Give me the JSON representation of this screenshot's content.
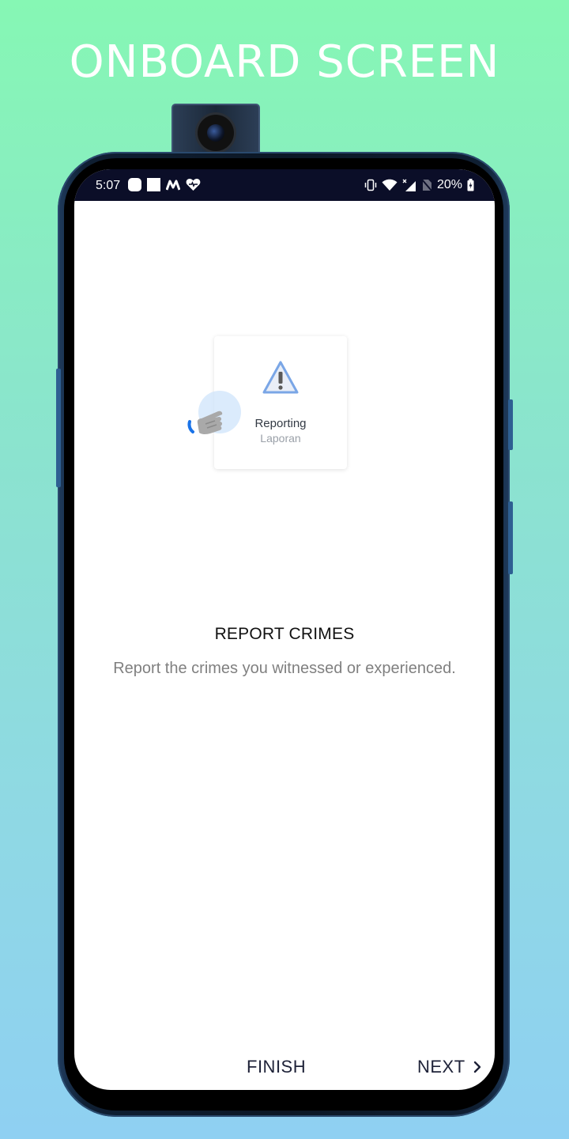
{
  "promo": {
    "title": "ONBOARD SCREEN"
  },
  "status_bar": {
    "time": "5:07",
    "left_icons": [
      "notification-icon",
      "square-icon",
      "m-app-icon",
      "heart-icon"
    ],
    "right_icons": [
      "vibrate-icon",
      "wifi-icon",
      "signal-icon",
      "no-sim-icon"
    ],
    "battery": "20%",
    "background": "#0b0e28"
  },
  "illustration": {
    "card_label": "Reporting",
    "card_sublabel": "Laporan",
    "card_icon": "warning-icon",
    "hand_icon": "tap-hand-icon"
  },
  "onboarding": {
    "title": "REPORT CRIMES",
    "description": "Report the crimes you witnessed or experienced."
  },
  "footer": {
    "finish_label": "FINISH",
    "next_label": "NEXT",
    "next_icon": "chevron-right-icon"
  },
  "colors": {
    "background_top": "#86f7b4",
    "background_bottom": "#8fd0f2",
    "accent_blue": "#1a73e8",
    "button_text": "#1e2238"
  }
}
